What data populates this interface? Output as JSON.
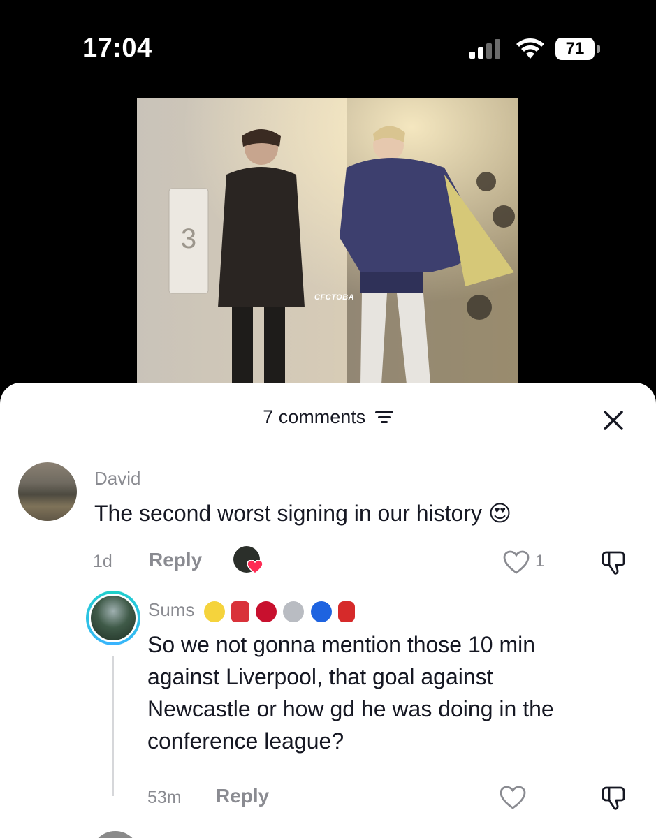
{
  "status_bar": {
    "time": "17:04",
    "battery": "71"
  },
  "video": {
    "watermark": "CFCTOBA"
  },
  "comments_sheet": {
    "title": "7 comments",
    "comments": [
      {
        "username": "David",
        "text": "The second worst signing in our history",
        "emoji": "😍",
        "age": "1d",
        "reply_label": "Reply",
        "likes": "1"
      }
    ],
    "replies": [
      {
        "username": "Sums",
        "username_emojis": [
          "🍋",
          "🎸",
          "🍒",
          "🪩",
          "🔵",
          "💃"
        ],
        "text_lines": [
          "So we not gonna mention those 10 min",
          "against Liverpool, that goal against",
          "Newcastle or how gd he was doing in the",
          "conference league?"
        ],
        "age": "53m",
        "reply_label": "Reply"
      }
    ]
  },
  "colors": {
    "text_primary": "#161823",
    "text_secondary": "#8a8b91",
    "heart_red": "#fe2c55",
    "ring_cyan": "#1fd1c8"
  }
}
